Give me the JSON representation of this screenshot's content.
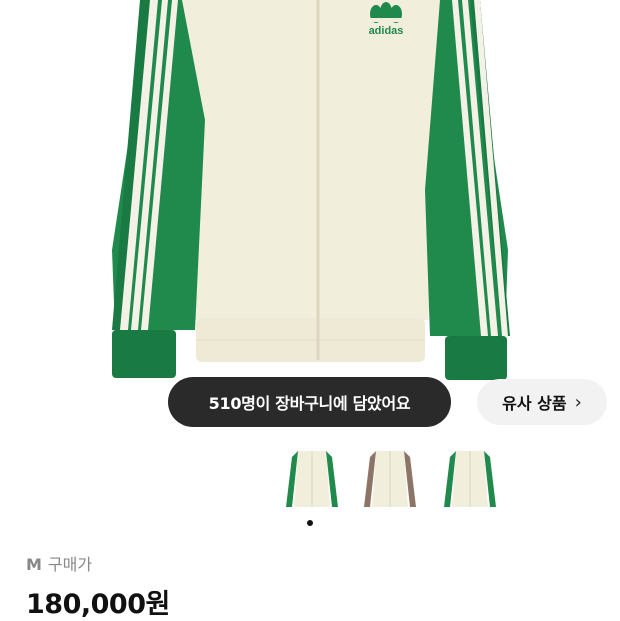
{
  "product": {
    "brand_logo_text": "adidas",
    "image_alt": "adidas green and cream track jacket"
  },
  "cart_notice": {
    "count": "510",
    "text": "510명이 장바구니에 담았어요"
  },
  "similar_button": {
    "label": "유사 상품",
    "icon": "chevron-right-icon"
  },
  "thumbnails": [
    {
      "name": "green-cream",
      "accent": "#1f8a4c",
      "body": "#f2eedc"
    },
    {
      "name": "brown-cream",
      "accent": "#8c7467",
      "body": "#f2eedc"
    },
    {
      "name": "green-cream-2",
      "accent": "#1f8a4c",
      "body": "#f2eedc"
    }
  ],
  "carousel": {
    "active_index": 1,
    "total": 1
  },
  "purchase_info": {
    "size": "M",
    "label": "구매가",
    "price": "180,000원"
  },
  "colors": {
    "jacket_green": "#1f8a4c",
    "jacket_cream": "#f2eedc",
    "pill_dark": "#2a2a2a"
  }
}
